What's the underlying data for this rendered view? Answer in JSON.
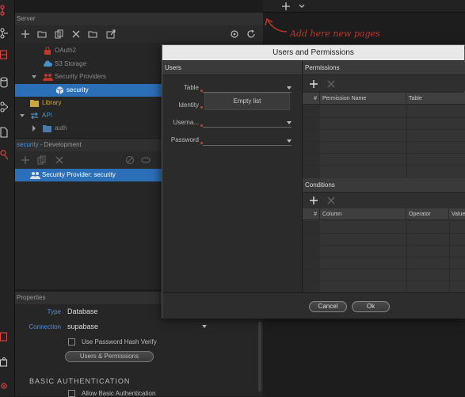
{
  "workspace": {
    "annotation": "Add here new pages"
  },
  "server_panel": {
    "title": "Server",
    "tree": [
      {
        "label": "OAuth2",
        "icon": "lock-icon"
      },
      {
        "label": "S3 Storage",
        "icon": "cloud-icon"
      },
      {
        "label": "Security Providers",
        "icon": "users-icon"
      },
      {
        "label": "security",
        "icon": "cube-icon",
        "selected": true
      },
      {
        "label": "Library",
        "icon": "folder-icon"
      },
      {
        "label": "API",
        "icon": "api-icon"
      },
      {
        "label": "auth",
        "icon": "folder-icon"
      }
    ]
  },
  "dev_panel": {
    "title_name": "security",
    "title_suffix": " - Development",
    "item": "Security Provider: security"
  },
  "properties": {
    "title": "Properties",
    "type_label": "Type",
    "type_value": "Database",
    "connection_label": "Connection",
    "connection_value": "supabase",
    "hash_verify": "Use Password Hash Verify",
    "users_permissions_button": "Users & Permissions",
    "basic_auth_heading": "BASIC AUTHENTICATION",
    "allow_basic_auth": "Allow Basic Authentication"
  },
  "dialog": {
    "title": "Users and Permissions",
    "users_section": "Users",
    "fields": {
      "table": "Table",
      "identity": "Identity",
      "username": "Userna...",
      "password": "Password"
    },
    "empty_list": "Empty list",
    "permissions_section": "Permissions",
    "permissions_columns": [
      "#",
      "Permission Name",
      "Table"
    ],
    "conditions_section": "Conditions",
    "conditions_columns": [
      "#",
      "Column",
      "Operator",
      "Value"
    ],
    "cancel": "Cancel",
    "ok": "Ok"
  },
  "colors": {
    "selection": "#2a6fb7",
    "annotation": "#c0392b",
    "required": "#dd3333",
    "library": "#c8a840"
  }
}
